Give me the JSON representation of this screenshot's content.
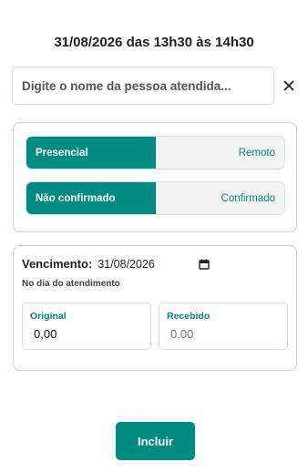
{
  "header": {
    "title": "31/08/2026 das 13h30 às 14h30"
  },
  "search": {
    "placeholder": "Digite o nome da pessoa atendida...",
    "value": "",
    "clear_icon": "close-icon"
  },
  "toggles": [
    {
      "selected": "Presencial",
      "other": "Remoto"
    },
    {
      "selected": "Não confirmado",
      "other": "Confirmado"
    }
  ],
  "due": {
    "label": "Vencimento:",
    "date": "31/08/2026",
    "date_icon": "calendar-icon",
    "note": "No dia do atendimento"
  },
  "amounts": {
    "original": {
      "label": "Original",
      "value": "0,00"
    },
    "received": {
      "label": "Recebido",
      "placeholder": "0,00"
    }
  },
  "actions": {
    "submit_label": "Incluir"
  },
  "colors": {
    "accent": "#008b82",
    "accent_text": "#0a857c",
    "border": "#cfcfcf"
  }
}
